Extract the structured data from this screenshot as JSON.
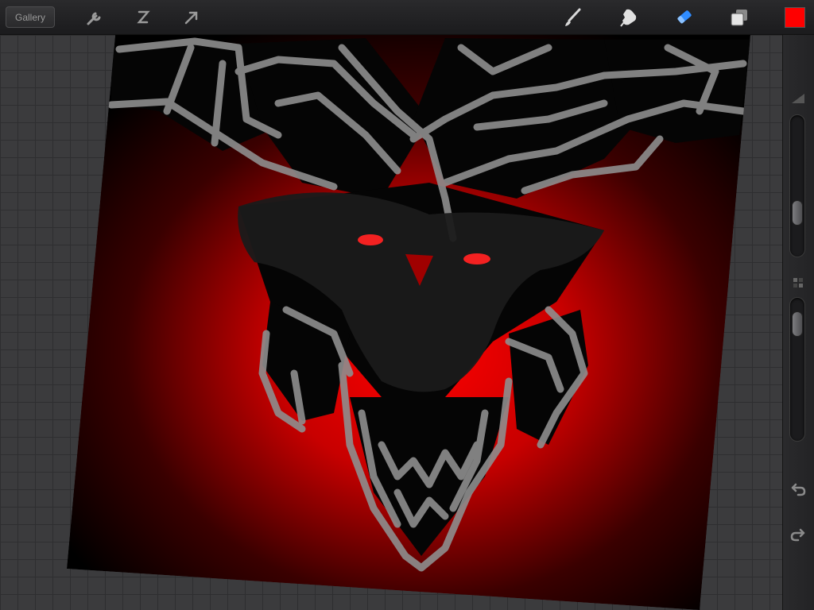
{
  "toolbar": {
    "gallery_label": "Gallery",
    "left_tools": [
      "wrench-icon",
      "selection-s-icon",
      "transform-arrow-icon"
    ],
    "right_tools": [
      "brush-icon",
      "smudge-icon",
      "eraser-icon",
      "layers-icon"
    ],
    "active_tool": "eraser-icon",
    "current_color": "#ff0000"
  },
  "sidebar": {
    "brush_size_level": 0.27,
    "opacity_level": 0.1,
    "controls": [
      "undo-icon",
      "redo-icon"
    ]
  },
  "canvas": {
    "background": "#000000",
    "glow_color": "#e00000",
    "sketch_color": "#8f8f8f",
    "eye_color": "#ff2020"
  }
}
